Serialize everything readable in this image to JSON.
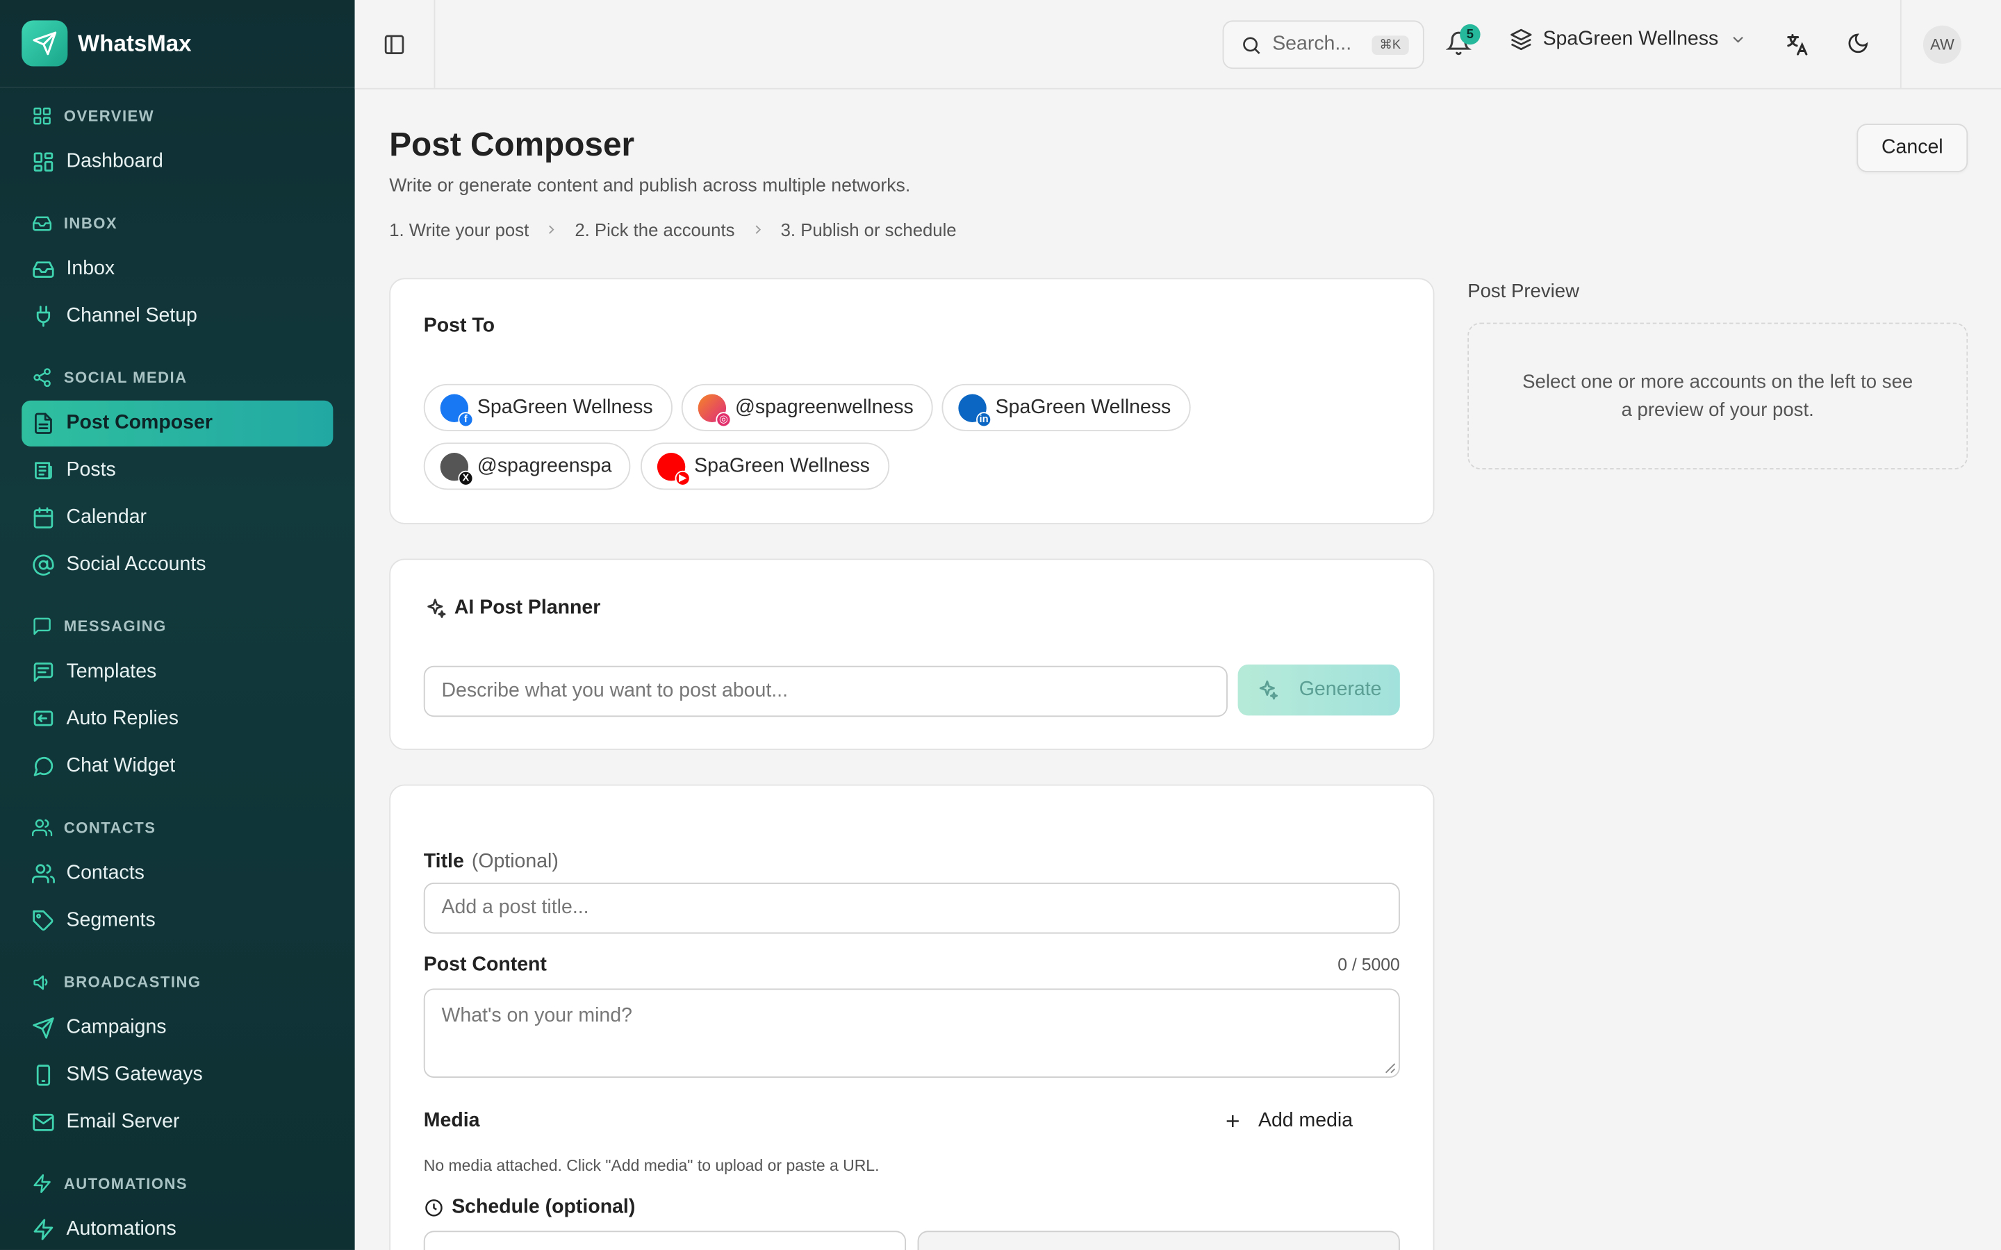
{
  "app": {
    "name": "WhatsMax"
  },
  "sidebar": {
    "sections": [
      {
        "title": "OVERVIEW",
        "icon": "grid-icon",
        "items": [
          {
            "label": "Dashboard",
            "icon": "dashboard-icon"
          }
        ]
      },
      {
        "title": "INBOX",
        "icon": "inbox-icon",
        "items": [
          {
            "label": "Inbox",
            "icon": "inbox-icon"
          },
          {
            "label": "Channel Setup",
            "icon": "plug-icon"
          }
        ]
      },
      {
        "title": "SOCIAL MEDIA",
        "icon": "share-icon",
        "items": [
          {
            "label": "Post Composer",
            "icon": "document-icon",
            "active": true
          },
          {
            "label": "Posts",
            "icon": "newspaper-icon"
          },
          {
            "label": "Calendar",
            "icon": "calendar-icon"
          },
          {
            "label": "Social Accounts",
            "icon": "at-sign-icon"
          }
        ]
      },
      {
        "title": "MESSAGING",
        "icon": "message-square-icon",
        "items": [
          {
            "label": "Templates",
            "icon": "template-icon"
          },
          {
            "label": "Auto Replies",
            "icon": "reply-icon"
          },
          {
            "label": "Chat Widget",
            "icon": "chat-bubble-icon"
          }
        ]
      },
      {
        "title": "CONTACTS",
        "icon": "users-icon",
        "items": [
          {
            "label": "Contacts",
            "icon": "users-icon"
          },
          {
            "label": "Segments",
            "icon": "tag-icon"
          }
        ]
      },
      {
        "title": "BROADCASTING",
        "icon": "megaphone-icon",
        "items": [
          {
            "label": "Campaigns",
            "icon": "send-icon"
          },
          {
            "label": "SMS Gateways",
            "icon": "phone-icon"
          },
          {
            "label": "Email Server",
            "icon": "mail-icon"
          }
        ]
      },
      {
        "title": "AUTOMATIONS",
        "icon": "zap-icon",
        "items": [
          {
            "label": "Automations",
            "icon": "zap-icon"
          }
        ]
      }
    ]
  },
  "header": {
    "search_placeholder": "Search...",
    "search_shortcut": "⌘K",
    "notification_count": "5",
    "workspace": "SpaGreen Wellness",
    "avatar_initials": "AW"
  },
  "page": {
    "title": "Post Composer",
    "subtitle": "Write or generate content and publish across multiple networks.",
    "cancel_label": "Cancel",
    "steps": [
      "1.  Write your post",
      "2.  Pick the accounts",
      "3.  Publish or schedule"
    ]
  },
  "post_to": {
    "title": "Post To",
    "accounts": [
      {
        "name": "SpaGreen Wellness",
        "network": "facebook",
        "color": "#1877f2"
      },
      {
        "name": "@spagreenwellness",
        "network": "instagram",
        "color": "#e1306c"
      },
      {
        "name": "SpaGreen Wellness",
        "network": "linkedin",
        "color": "#0a66c2"
      },
      {
        "name": "@spagreenspa",
        "network": "x",
        "color": "#111111"
      },
      {
        "name": "SpaGreen Wellness",
        "network": "youtube",
        "color": "#ff0000"
      }
    ]
  },
  "ai_planner": {
    "title": "AI Post Planner",
    "placeholder": "Describe what you want to post about...",
    "generate_label": "Generate"
  },
  "form": {
    "title_label": "Title",
    "title_optional": "(Optional)",
    "title_placeholder": "Add a post title...",
    "content_label": "Post Content",
    "content_counter": "0 / 5000",
    "content_placeholder": "What's on your mind?",
    "media_label": "Media",
    "add_media_label": "Add media",
    "media_note": "No media attached. Click \"Add media\" to upload or paste a URL.",
    "schedule_label": "Schedule (optional)"
  },
  "preview": {
    "title": "Post Preview",
    "empty_text": "Select one or more accounts on the left to see a preview of your post."
  },
  "colors": {
    "accent": "#2fbf9f",
    "sidebar_bg": "#0f2f33"
  }
}
